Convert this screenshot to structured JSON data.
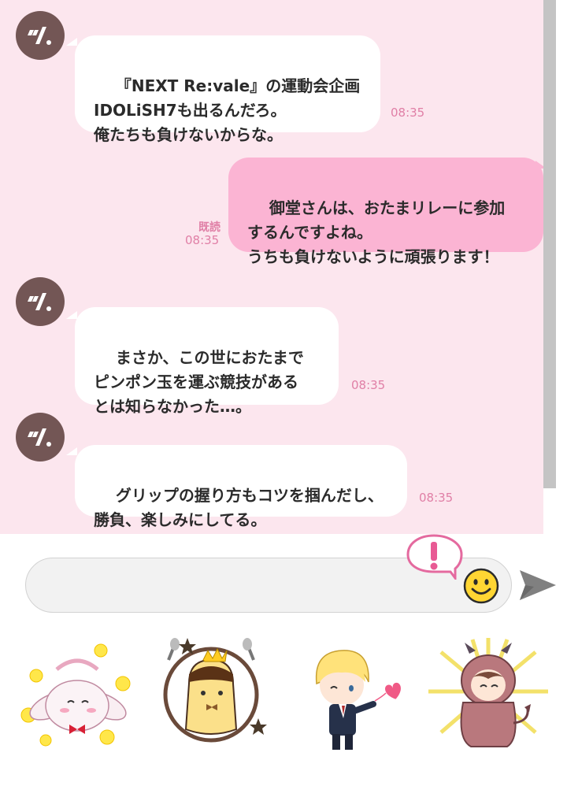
{
  "chat": {
    "messages": [
      {
        "direction": "incoming",
        "avatar_icon": "chevron-slash-icon",
        "text": "『NEXT Re:vale』の運動会企画\nIDOLiSH7も出るんだろ。\n俺たちも負けないからな。",
        "time": "08:35"
      },
      {
        "direction": "outgoing",
        "read_label": "既読",
        "text": "御堂さんは、おたまリレーに参加\nするんですよね。\nうちも負けないように頑張ります！",
        "time": "08:35"
      },
      {
        "direction": "incoming",
        "avatar_icon": "chevron-slash-icon",
        "text": "まさか、この世におたまで\nピンポン玉を運ぶ競技がある\nとは知らなかった…。",
        "time": "08:35"
      },
      {
        "direction": "incoming",
        "avatar_icon": "chevron-slash-icon",
        "text": "グリップの握り方もコツを掴んだし、\n勝負、楽しみにしてる。",
        "time": "08:35"
      }
    ]
  },
  "input": {
    "value": "",
    "emoji_icon": "smiley-icon",
    "alert_icon": "exclamation-bubble-icon",
    "send_icon": "send-arrow-icon"
  },
  "stickers": [
    {
      "name": "sticker-rabbit"
    },
    {
      "name": "sticker-pudding-crown"
    },
    {
      "name": "sticker-blonde-character-heart"
    },
    {
      "name": "sticker-costume-character"
    }
  ],
  "colors": {
    "chat_background": "#fce6ee",
    "outgoing_bubble": "#fbb4d3",
    "incoming_bubble": "#ffffff",
    "timestamp": "#e07fa6",
    "avatar": "#735655"
  }
}
